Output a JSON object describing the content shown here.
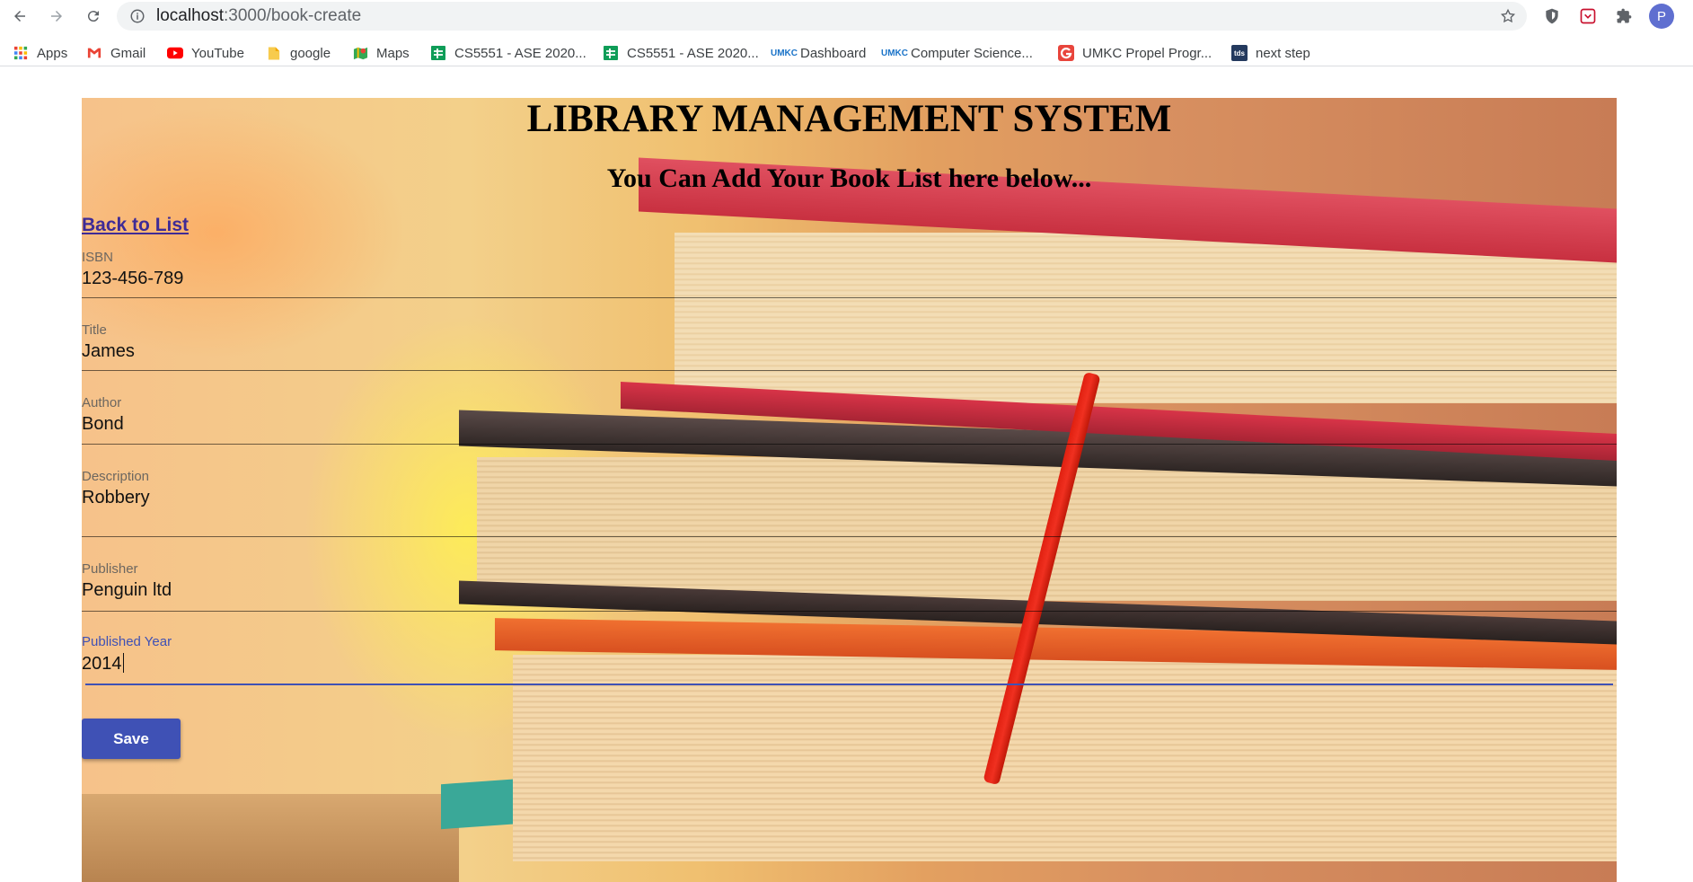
{
  "browser": {
    "url_host": "localhost",
    "url_path": ":3000/book-create",
    "profile_initial": "P",
    "bookmarks": [
      {
        "label": "Apps",
        "icon": "apps-grid-icon"
      },
      {
        "label": "Gmail",
        "icon": "gmail-icon"
      },
      {
        "label": "YouTube",
        "icon": "youtube-icon"
      },
      {
        "label": "google",
        "icon": "folder-icon"
      },
      {
        "label": "Maps",
        "icon": "maps-icon"
      },
      {
        "label": "CS5551 - ASE 2020...",
        "icon": "sheets-icon"
      },
      {
        "label": "CS5551 - ASE 2020...",
        "icon": "sheets-icon"
      },
      {
        "label": "Dashboard",
        "icon": "umkc-icon"
      },
      {
        "label": "Computer Science...",
        "icon": "umkc-icon"
      },
      {
        "label": "UMKC Propel Progr...",
        "icon": "g-icon"
      },
      {
        "label": "next step",
        "icon": "tds-icon"
      }
    ]
  },
  "page": {
    "title": "LIBRARY MANAGEMENT SYSTEM",
    "subtitle": "You Can Add Your Book List here below...",
    "back_link": "Back to List",
    "fields": [
      {
        "label": "ISBN",
        "value": "123-456-789"
      },
      {
        "label": "Title",
        "value": "James"
      },
      {
        "label": "Author",
        "value": "Bond"
      },
      {
        "label": "Description",
        "value": "Robbery"
      },
      {
        "label": "Publisher",
        "value": "Penguin ltd"
      },
      {
        "label": "Published Year",
        "value": "2014"
      }
    ],
    "save_label": "Save"
  },
  "colors": {
    "accent": "#3f51b5",
    "link": "#3f2b96"
  }
}
